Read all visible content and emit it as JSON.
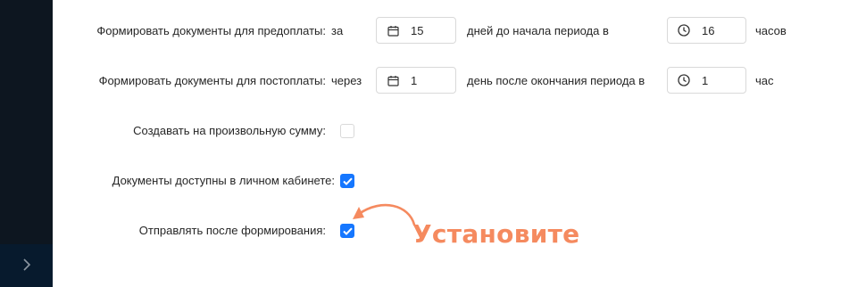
{
  "prepay": {
    "label": "Формировать документы для предоплаты",
    "prefix": "за",
    "days_value": "15",
    "middle": "дней до начала периода в",
    "hours_value": "16",
    "suffix": "часов"
  },
  "postpay": {
    "label": "Формировать документы для постоплаты",
    "prefix": "через",
    "days_value": "1",
    "middle": "день после окончания периода в",
    "hours_value": "1",
    "suffix": "час"
  },
  "custom_amount": {
    "label": "Создавать на произвольную сумму",
    "checked": false
  },
  "personal_cabinet": {
    "label": "Документы доступны в личном кабинете",
    "checked": true
  },
  "send_after": {
    "label": "Отправлять после формирования",
    "checked": true
  },
  "colon": ":",
  "annotation": {
    "text": "Установите",
    "color": "#f58a5f"
  },
  "icons": [
    "calendar-icon",
    "clock-icon",
    "chevron-right-icon",
    "check-icon",
    "curved-arrow-icon"
  ],
  "colors": {
    "accent": "#1677ff",
    "sidebar": "#0d1620"
  }
}
